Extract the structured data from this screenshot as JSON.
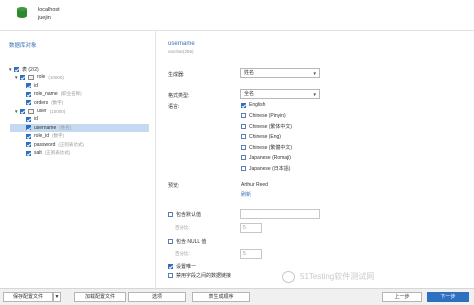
{
  "connection": {
    "host": "localhost",
    "database": "juejin"
  },
  "left": {
    "title": "数据库对象",
    "tree": [
      {
        "label": "表 (2/2)",
        "type": "",
        "checked": true,
        "expanded": true,
        "kind": "group"
      },
      {
        "label": "role",
        "type": "(10000)",
        "checked": true,
        "expanded": true,
        "kind": "table"
      },
      {
        "label": "id",
        "type": "",
        "checked": true,
        "kind": "field"
      },
      {
        "label": "role_name",
        "type": "(职业名称)",
        "checked": true,
        "kind": "field"
      },
      {
        "label": "orders",
        "type": "(数字)",
        "checked": true,
        "kind": "field"
      },
      {
        "label": "user",
        "type": "(10000)",
        "checked": true,
        "expanded": true,
        "kind": "table"
      },
      {
        "label": "id",
        "type": "",
        "checked": true,
        "kind": "field"
      },
      {
        "label": "username",
        "type": "(姓名)",
        "checked": true,
        "kind": "field",
        "selected": true
      },
      {
        "label": "role_id",
        "type": "(数字)",
        "checked": true,
        "kind": "field"
      },
      {
        "label": "password",
        "type": "(正则表达式)",
        "checked": true,
        "kind": "field"
      },
      {
        "label": "salt",
        "type": "(正则表达式)",
        "checked": true,
        "kind": "field"
      }
    ]
  },
  "field": {
    "name": "username",
    "type": "varchar(255)",
    "generator_label": "生成器:",
    "generator_value": "姓名",
    "format_label": "格式类型:",
    "format_value": "全名",
    "language_label": "语言:",
    "languages": [
      {
        "label": "English",
        "checked": true
      },
      {
        "label": "Chinese (Pinyin)",
        "checked": false
      },
      {
        "label": "Chinese (繁体中文)",
        "checked": false
      },
      {
        "label": "Chinese (Eng)",
        "checked": false
      },
      {
        "label": "Chinese (繁體中文)",
        "checked": false
      },
      {
        "label": "Japanese (Romaji)",
        "checked": false
      },
      {
        "label": "Japanese (日本語)",
        "checked": false
      }
    ],
    "preview_label": "预览:",
    "preview_value": "Arthur Reed",
    "refresh_link": "刷新",
    "include_default_label": "包含默认值",
    "default_ratio_label": "百分比:",
    "default_ratio_value": "5",
    "include_null_label": "包含 NULL 值",
    "null_ratio_label": "百分比:",
    "null_ratio_value": "5",
    "unique_label": "设置唯一",
    "unique_checked": true,
    "disable_label": "禁用字段之间的数据链接"
  },
  "watermark": "51Testing软件测试网",
  "footer": {
    "save_profile": "保存配置文件",
    "load_profile": "加载配置文件",
    "options": "选项",
    "generate_order": "表生成顺序",
    "prev": "上一步",
    "next": "下一步"
  },
  "colors": {
    "accent": "#2f6fc0",
    "title_blue": "#3a6fb5",
    "selected_bg": "#c5d9f0"
  }
}
